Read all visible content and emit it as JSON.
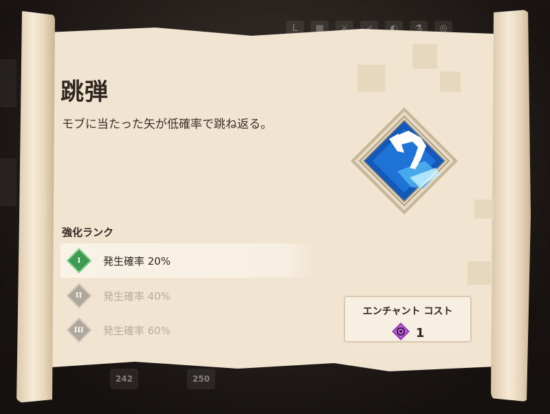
{
  "background": {
    "topbar_icons": [
      "L",
      "grid-icon",
      "sword-icon",
      "bow-icon",
      "helmet-icon",
      "potion-icon",
      "spiral-icon"
    ],
    "bottom_counts": [
      "242",
      "250"
    ]
  },
  "enchant": {
    "title": "跳弾",
    "description": "モブに当たった矢が低確率で跳ね返る。",
    "icon": "ricochet-arrow-icon",
    "icon_colors": {
      "frame": "#c9b79b",
      "fill": "#1459b8",
      "glow": "#8fe3ff"
    }
  },
  "ranks": {
    "heading": "強化ランク",
    "items": [
      {
        "numeral": "I",
        "text": "発生確率 20%",
        "active": true
      },
      {
        "numeral": "II",
        "text": "発生確率 40%",
        "active": false
      },
      {
        "numeral": "III",
        "text": "発生確率 60%",
        "active": false
      }
    ]
  },
  "cost": {
    "label": "エンチャント コスト",
    "value": "1",
    "icon": "enchant-point-icon",
    "icon_color": "#9b3fb8"
  },
  "colors": {
    "parchment": "#f1e4d0",
    "text_dark": "#2f2620",
    "rank_active": "#3e9a52",
    "rank_inactive": "#b0a69b"
  }
}
